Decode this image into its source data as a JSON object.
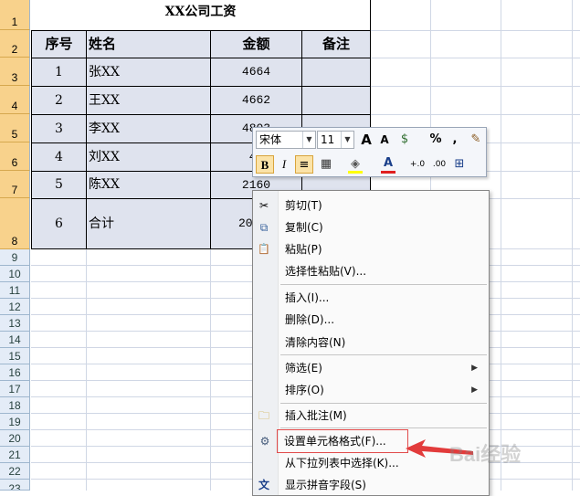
{
  "sheet": {
    "row_numbers": [
      "1",
      "2",
      "3",
      "4",
      "5",
      "6",
      "7",
      "8",
      "9",
      "10",
      "11",
      "12",
      "13",
      "14",
      "15",
      "16",
      "17",
      "18",
      "19",
      "20",
      "21",
      "22",
      "23"
    ],
    "title": "XX公司工资",
    "headers": [
      "序号",
      "姓名",
      "金额",
      "备注"
    ],
    "rows": [
      {
        "no": "1",
        "name": "张XX",
        "amount": "4664",
        "note": ""
      },
      {
        "no": "2",
        "name": "王XX",
        "amount": "4662",
        "note": ""
      },
      {
        "no": "3",
        "name": "李XX",
        "amount": "4803",
        "note": ""
      },
      {
        "no": "4",
        "name": "刘XX",
        "amount": "45",
        "note": ""
      },
      {
        "no": "5",
        "name": "陈XX",
        "amount": "2160",
        "note": ""
      },
      {
        "no": "6",
        "name": "合计",
        "amount": "20",
        "note": ""
      }
    ]
  },
  "mini_toolbar": {
    "font_name": "宋体",
    "font_size": "11",
    "grow_font": "A",
    "shrink_font": "A",
    "currency": "$",
    "percent": "%",
    "comma": ",",
    "format_painter": "✎",
    "bold": "B",
    "italic": "I",
    "center": "≡",
    "borders": "▦",
    "fill": "◈",
    "font_color": "A",
    "inc_decimal": "+.0",
    "dec_decimal": ".00",
    "merge": "⊞",
    "colors": {
      "fill": "#ffff00",
      "font": "#e02020"
    }
  },
  "context_menu": {
    "items": [
      {
        "label": "剪切(T)",
        "icon": "scissors-icon",
        "glyph": "✂"
      },
      {
        "label": "复制(C)",
        "icon": "copy-icon",
        "glyph": "⧉"
      },
      {
        "label": "粘贴(P)",
        "icon": "paste-icon",
        "glyph": "📋"
      },
      {
        "label": "选择性粘贴(V)...",
        "icon": "",
        "glyph": ""
      },
      {
        "label": "插入(I)...",
        "icon": "",
        "glyph": ""
      },
      {
        "label": "删除(D)...",
        "icon": "",
        "glyph": ""
      },
      {
        "label": "清除内容(N)",
        "icon": "",
        "glyph": ""
      },
      {
        "label": "筛选(E)",
        "icon": "",
        "glyph": ""
      },
      {
        "label": "排序(O)",
        "icon": "",
        "glyph": ""
      },
      {
        "label": "插入批注(M)",
        "icon": "comment-icon",
        "glyph": "🗀"
      },
      {
        "label": "设置单元格格式(F)...",
        "icon": "format-cells-icon",
        "glyph": "⚙"
      },
      {
        "label": "从下拉列表中选择(K)...",
        "icon": "",
        "glyph": ""
      },
      {
        "label": "显示拼音字段(S)",
        "icon": "phonetic-icon",
        "glyph": "文"
      }
    ],
    "highlight_color": "#e14b4b"
  },
  "watermark": "Bai经验"
}
